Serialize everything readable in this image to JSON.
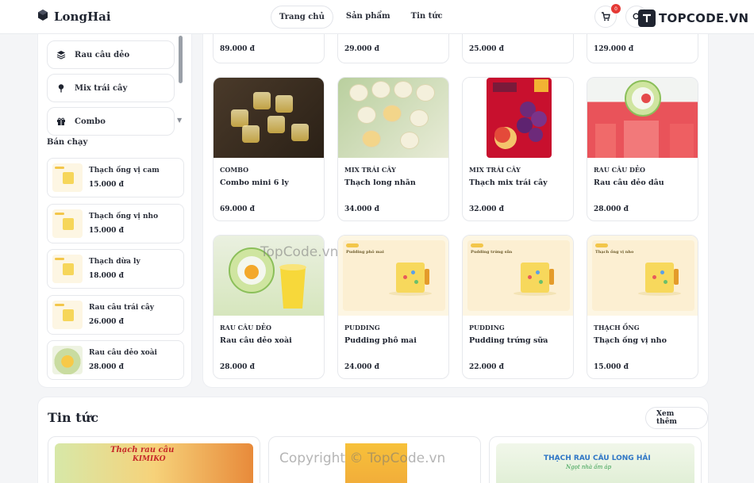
{
  "header": {
    "logo": "LongHai",
    "nav": [
      {
        "label": "Trang chủ",
        "active": true
      },
      {
        "label": "Sản phẩm",
        "active": false
      },
      {
        "label": "Tin tức",
        "active": false
      }
    ],
    "cart_count": "0",
    "brand_watermark": "TOPCODE.VN"
  },
  "sidebar": {
    "categories": [
      {
        "label": "Rau câu dẻo",
        "icon": "layers-icon"
      },
      {
        "label": "Mix trái cây",
        "icon": "pin-icon"
      },
      {
        "label": "Combo",
        "icon": "gift-icon"
      }
    ],
    "best_title": "Bán chạy",
    "best_sellers": [
      {
        "name": "Thạch ống vị cam",
        "price": "15.000 đ"
      },
      {
        "name": "Thạch ống vị nho",
        "price": "15.000 đ"
      },
      {
        "name": "Thạch dừa ly",
        "price": "18.000 đ"
      },
      {
        "name": "Rau câu trái cây",
        "price": "26.000 đ"
      },
      {
        "name": "Rau câu dẻo xoài",
        "price": "28.000 đ"
      }
    ]
  },
  "products": {
    "top_prices": [
      "89.000 đ",
      "29.000 đ",
      "25.000 đ",
      "129.000 đ"
    ],
    "items": [
      {
        "category": "COMBO",
        "name": "Combo mini 6 ly",
        "price": "69.000 đ"
      },
      {
        "category": "MIX TRÁI CÂY",
        "name": "Thạch long nhãn",
        "price": "34.000 đ"
      },
      {
        "category": "MIX TRÁI CÂY",
        "name": "Thạch mix trái cây",
        "price": "32.000 đ"
      },
      {
        "category": "RAU CÂU DẺO",
        "name": "Rau câu dẻo dâu",
        "price": "28.000 đ"
      },
      {
        "category": "RAU CÂU DẺO",
        "name": "Rau câu dẻo xoài",
        "price": "28.000 đ"
      },
      {
        "category": "PUDDING",
        "name": "Pudding phô mai",
        "price": "24.000 đ"
      },
      {
        "category": "PUDDING",
        "name": "Pudding trứng sữa",
        "price": "22.000 đ"
      },
      {
        "category": "THẠCH ỐNG",
        "name": "Thạch ống vị nho",
        "price": "15.000 đ"
      }
    ],
    "thumb_labels": [
      "Pudding phô mai",
      "Pudding trứng sữa",
      "Thạch ống vị nho"
    ]
  },
  "news": {
    "title": "Tin tức",
    "more": "Xem thêm",
    "banners": [
      {
        "line1": "Thạch rau câu",
        "line2": "KIMIKO"
      },
      {
        "line1": "",
        "line2": ""
      },
      {
        "line1": "THẠCH RAU CÂU LONG HẢI",
        "line2": "Ngọt nhà ấm áp"
      }
    ]
  },
  "watermarks": {
    "center": "TopCode.vn",
    "bottom": "Copyright © TopCode.vn"
  },
  "colors": {
    "badge": "#e53935",
    "price_label": "#f3c64a",
    "cup": "#f7d85c"
  }
}
